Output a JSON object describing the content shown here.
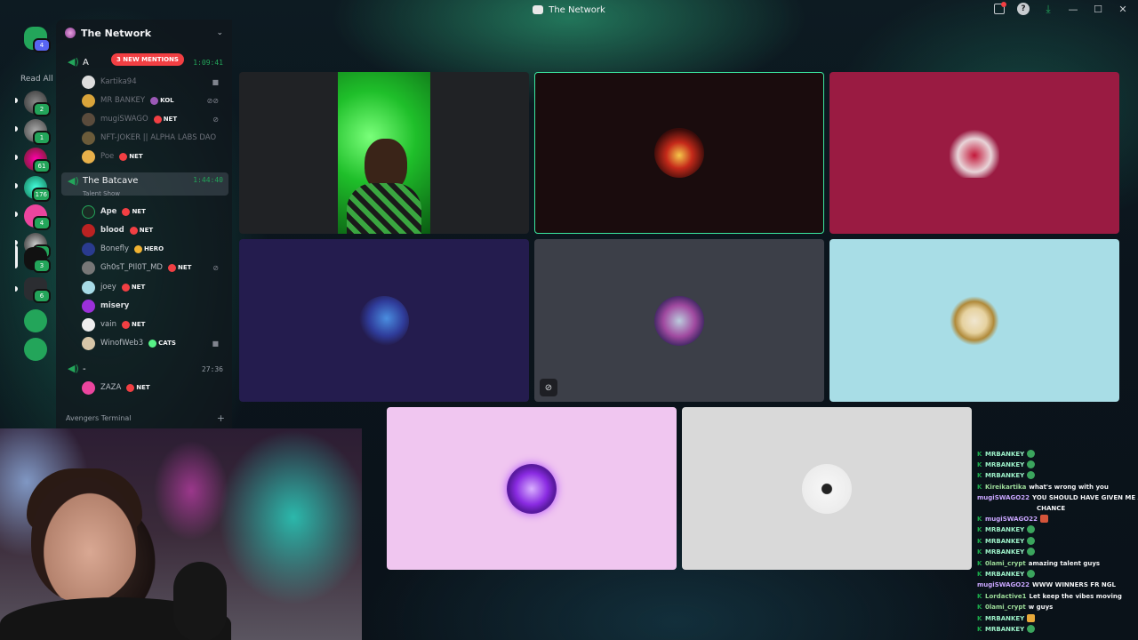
{
  "window": {
    "title": "The Network"
  },
  "rail": {
    "read_all": "Read All",
    "badges": [
      "4",
      "2",
      "1",
      "61",
      "176",
      "4",
      "1",
      "3",
      "6"
    ]
  },
  "guild": {
    "name": "The Network"
  },
  "channels": {
    "mention_pill": "3 NEW MENTIONS",
    "vc1": {
      "name": "A",
      "timer": "1:09:41"
    },
    "vc1_members": [
      {
        "name": "Kartika94",
        "tag": ""
      },
      {
        "name": "MR BANKEY",
        "tag": "KOL"
      },
      {
        "name": "mugiSWAGO",
        "tag": "NET"
      },
      {
        "name": "NFT-JOKER || ALPHA LABS DAO",
        "tag": ""
      },
      {
        "name": "Poe",
        "tag": "NET"
      }
    ],
    "vc2": {
      "name": "The Batcave",
      "status": "Talent Show",
      "timer": "1:44:40"
    },
    "vc2_members": [
      {
        "name": "Ape",
        "tag": "NET"
      },
      {
        "name": "blood",
        "tag": "NET"
      },
      {
        "name": "Bonefly",
        "tag": "HERO"
      },
      {
        "name": "Gh0sT_PIl0T_MD",
        "tag": "NET"
      },
      {
        "name": "joey",
        "tag": "NET"
      },
      {
        "name": "misery",
        "tag": ""
      },
      {
        "name": "vain",
        "tag": "NET"
      },
      {
        "name": "WinofWeb3",
        "tag": "CATS"
      }
    ],
    "vc3": {
      "name": "-",
      "timer": "27:36"
    },
    "vc3_members": [
      {
        "name": "ZAZA",
        "tag": "NET"
      }
    ],
    "category": "Avengers Terminal"
  },
  "chat": [
    {
      "user": "MRBANKEY",
      "msg": ""
    },
    {
      "user": "MRBANKEY",
      "msg": ""
    },
    {
      "user": "MRBANKEY",
      "msg": ""
    },
    {
      "user": "Kireikartika",
      "msg": "what's wrong with you"
    },
    {
      "user": "mugiSWAGO22",
      "msg": "YOU SHOULD HAVE GIVEN ME A"
    },
    {
      "user": "",
      "msg": "CHANCE"
    },
    {
      "user": "mugiSWAGO22",
      "msg": ""
    },
    {
      "user": "MRBANKEY",
      "msg": ""
    },
    {
      "user": "MRBANKEY",
      "msg": ""
    },
    {
      "user": "MRBANKEY",
      "msg": ""
    },
    {
      "user": "0lami_crypt",
      "msg": "amazing talent guys"
    },
    {
      "user": "MRBANKEY",
      "msg": ""
    },
    {
      "user": "mugiSWAGO22",
      "msg": "WWW WINNERS FR NGL"
    },
    {
      "user": "Lordactive1",
      "msg": "Let keep the vibes moving"
    },
    {
      "user": "0lami_crypt",
      "msg": "w guys"
    },
    {
      "user": "MRBANKEY",
      "msg": ""
    },
    {
      "user": "MRBANKEY",
      "msg": ""
    }
  ]
}
